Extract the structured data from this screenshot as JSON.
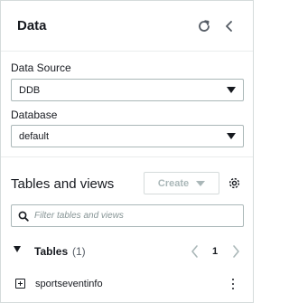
{
  "header": {
    "title": "Data",
    "refresh_icon": "refresh-icon",
    "collapse_icon": "chevron-left-icon"
  },
  "data_source": {
    "label": "Data Source",
    "value": "DDB"
  },
  "database": {
    "label": "Database",
    "value": "default"
  },
  "tables_and_views": {
    "title": "Tables and views",
    "create_label": "Create",
    "settings_icon": "gear-icon",
    "search_placeholder": "Filter tables and views"
  },
  "tables": {
    "label": "Tables",
    "count": "(1)",
    "page": "1",
    "items": [
      {
        "name": "sportseventinfo"
      }
    ]
  },
  "colors": {
    "text": "#16191f",
    "border": "#aab7b8",
    "disabled": "#aab7b8",
    "divider": "#eaeded"
  }
}
